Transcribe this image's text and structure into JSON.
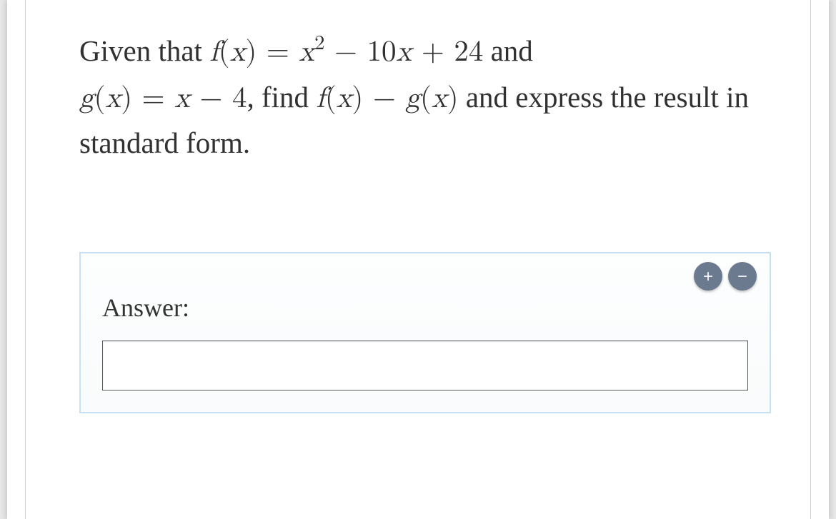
{
  "question": {
    "text_prefix": "Given that ",
    "f_eq": "f(x) = x² − 10x + 24",
    "text_and": " and ",
    "g_eq": "g(x) = x − 4",
    "text_find": ", find ",
    "fg_expr": "f(x) − g(x)",
    "text_suffix": " and express the result in standard form."
  },
  "answer": {
    "label": "Answer:",
    "value": "",
    "plus_icon": "plus-icon",
    "minus_icon": "minus-icon"
  }
}
